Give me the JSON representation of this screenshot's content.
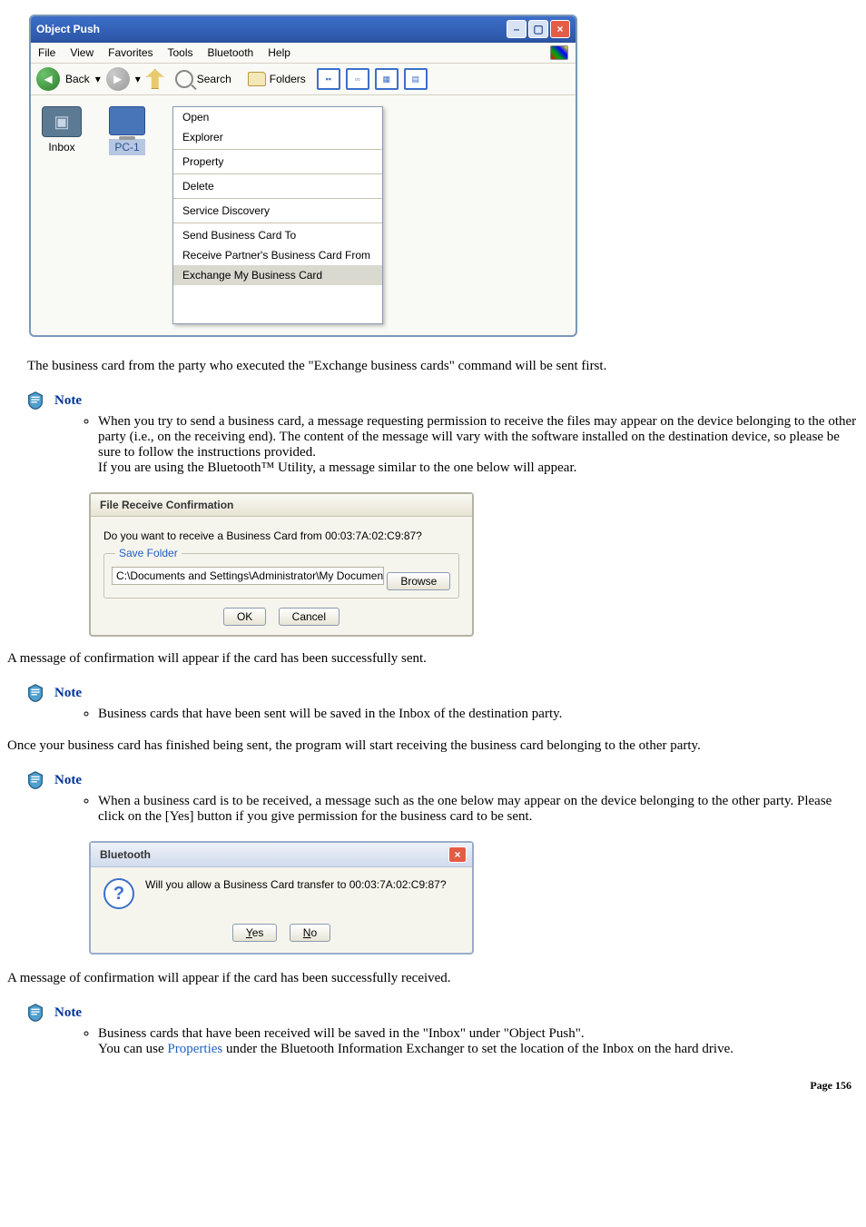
{
  "window": {
    "title": "Object Push",
    "menus": [
      "File",
      "View",
      "Favorites",
      "Tools",
      "Bluetooth",
      "Help"
    ],
    "toolbar": {
      "back": "Back",
      "search": "Search",
      "folders": "Folders"
    },
    "devices": {
      "inbox": "Inbox",
      "pc": "PC-1"
    },
    "context_menu": [
      "Open",
      "Explorer",
      "Property",
      "Delete",
      "Service Discovery",
      "Send Business Card To",
      "Receive Partner's Business Card From",
      "Exchange My Business Card"
    ]
  },
  "para_after_window": "The business card from the party who executed the \"Exchange business cards\" command will be sent first.",
  "note_label": "Note",
  "note1_item": "When you try to send a business card, a message requesting permission to receive the files may appear on the device belonging to the other party (i.e., on the receiving end). The content of the message will vary with the software installed on the destination device, so please be sure to follow the instructions provided.",
  "note1_sub": "If you are using the Bluetooth™ Utility, a message similar to the one below will appear.",
  "dlg1": {
    "title": "File Receive Confirmation",
    "question": "Do you want to receive a Business Card from 00:03:7A:02:C9:87?",
    "legend": "Save Folder",
    "path": "C:\\Documents and Settings\\Administrator\\My Document:",
    "browse": "Browse",
    "ok": "OK",
    "cancel": "Cancel"
  },
  "para_after_dlg1": "A message of confirmation will appear if the card has been successfully sent.",
  "note2_item": "Business cards that have been sent will be saved in the Inbox of the destination party.",
  "para_after_note2": "Once your business card has finished being sent, the program will start receiving the business card belonging to the other party.",
  "note3_item": "When a business card is to be received, a message such as the one below may appear on the device belonging to the other party. Please click on the [Yes] button if you give permission for the business card to be sent.",
  "dlg2": {
    "title": "Bluetooth",
    "question": "Will you allow a Business Card transfer to 00:03:7A:02:C9:87?",
    "yes": "Yes",
    "no": "No"
  },
  "para_after_dlg2": "A message of confirmation will appear if the card has been successfully received.",
  "note4_item": "Business cards that have been received will be saved in the \"Inbox\" under \"Object Push\".",
  "note4_sub_pre": "You can use ",
  "note4_sub_link": "Properties",
  "note4_sub_post": " under the Bluetooth Information Exchanger to set the location of the Inbox on the hard drive.",
  "page_footer": "Page 156"
}
